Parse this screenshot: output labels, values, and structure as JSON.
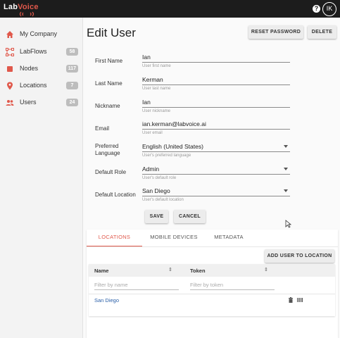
{
  "app": {
    "logo_prefix": "Lab",
    "logo_suffix": "Voice",
    "help_glyph": "?",
    "user_initials": "IK"
  },
  "sidebar": {
    "items": [
      {
        "label": "My Company",
        "icon": "home-icon",
        "count": ""
      },
      {
        "label": "LabFlows",
        "icon": "flow-icon",
        "count": "58"
      },
      {
        "label": "Nodes",
        "icon": "node-square-icon",
        "count": "117"
      },
      {
        "label": "Locations",
        "icon": "location-pin-icon",
        "count": "7"
      },
      {
        "label": "Users",
        "icon": "people-icon",
        "count": "24"
      }
    ]
  },
  "page": {
    "title": "Edit User",
    "reset_password_label": "RESET PASSWORD",
    "delete_label": "DELETE"
  },
  "form": {
    "first_name": {
      "label": "First Name",
      "value": "Ian",
      "hint": "User first name"
    },
    "last_name": {
      "label": "Last Name",
      "value": "Kerman",
      "hint": "User last name"
    },
    "nickname": {
      "label": "Nickname",
      "value": "Ian",
      "hint": "User nickname"
    },
    "email": {
      "label": "Email",
      "value": "ian.kerman@labvoice.ai",
      "hint": "User email"
    },
    "language": {
      "label_line1": "Preferred",
      "label_line2": "Language",
      "value": "English (United States)",
      "hint": "User's preferred language"
    },
    "role": {
      "label": "Default Role",
      "value": "Admin",
      "hint": "User's default role"
    },
    "location": {
      "label": "Default Location",
      "value": "San Diego",
      "hint": "User's default location"
    },
    "save_label": "SAVE",
    "cancel_label": "CANCEL"
  },
  "tabs": [
    {
      "label": "LOCATIONS",
      "active": true
    },
    {
      "label": "MOBILE DEVICES",
      "active": false
    },
    {
      "label": "METADATA",
      "active": false
    }
  ],
  "locations": {
    "add_label": "ADD USER TO LOCATION",
    "columns": [
      "Name",
      "Token"
    ],
    "sort_glyph": "⇕",
    "filters": [
      "Filter by name",
      "Filter by token"
    ],
    "rows": [
      {
        "name": "San Diego",
        "token": ""
      }
    ]
  },
  "colors": {
    "accent": "#e0584b",
    "topbar": "#1c1c1c",
    "link": "#2a5fa8"
  }
}
